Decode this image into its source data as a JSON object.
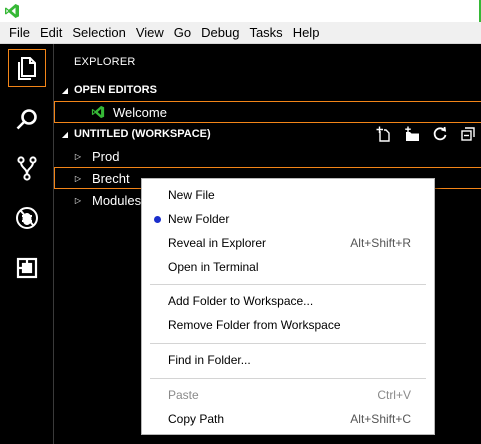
{
  "app": {
    "icon": "vscode-icon",
    "accent": "#36b836"
  },
  "menubar": {
    "items": [
      "File",
      "Edit",
      "Selection",
      "View",
      "Go",
      "Debug",
      "Tasks",
      "Help"
    ]
  },
  "activitybar": {
    "items": [
      {
        "icon": "explorer-icon",
        "active": true
      },
      {
        "icon": "search-icon",
        "active": false
      },
      {
        "icon": "source-control-icon",
        "active": false
      },
      {
        "icon": "debug-icon",
        "active": false
      },
      {
        "icon": "extensions-icon",
        "active": false
      }
    ]
  },
  "sidebar": {
    "title": "EXPLORER",
    "open_editors": {
      "header": "OPEN EDITORS",
      "items": [
        {
          "label": "Welcome",
          "icon": "vscode-icon"
        }
      ]
    },
    "workspace": {
      "header": "UNTITLED (WORKSPACE)",
      "actions": [
        "new-file-icon",
        "new-folder-icon",
        "refresh-icon",
        "collapse-all-icon"
      ],
      "folders": [
        {
          "label": "Prod"
        },
        {
          "label": "Brecht"
        },
        {
          "label": "Modules"
        }
      ]
    }
  },
  "context_menu": {
    "groups": [
      [
        {
          "label": "New File",
          "shortcut": ""
        },
        {
          "label": "New Folder",
          "shortcut": ""
        },
        {
          "label": "Reveal in Explorer",
          "shortcut": "Alt+Shift+R"
        },
        {
          "label": "Open in Terminal",
          "shortcut": ""
        }
      ],
      [
        {
          "label": "Add Folder to Workspace...",
          "shortcut": ""
        },
        {
          "label": "Remove Folder from Workspace",
          "shortcut": ""
        }
      ],
      [
        {
          "label": "Find in Folder...",
          "shortcut": ""
        }
      ],
      [
        {
          "label": "Paste",
          "shortcut": "Ctrl+V"
        },
        {
          "label": "Copy Path",
          "shortcut": "Alt+Shift+C"
        }
      ]
    ]
  },
  "colors": {
    "focus_outline": "#f38518",
    "menu_bullet": "#1a2ecc"
  }
}
